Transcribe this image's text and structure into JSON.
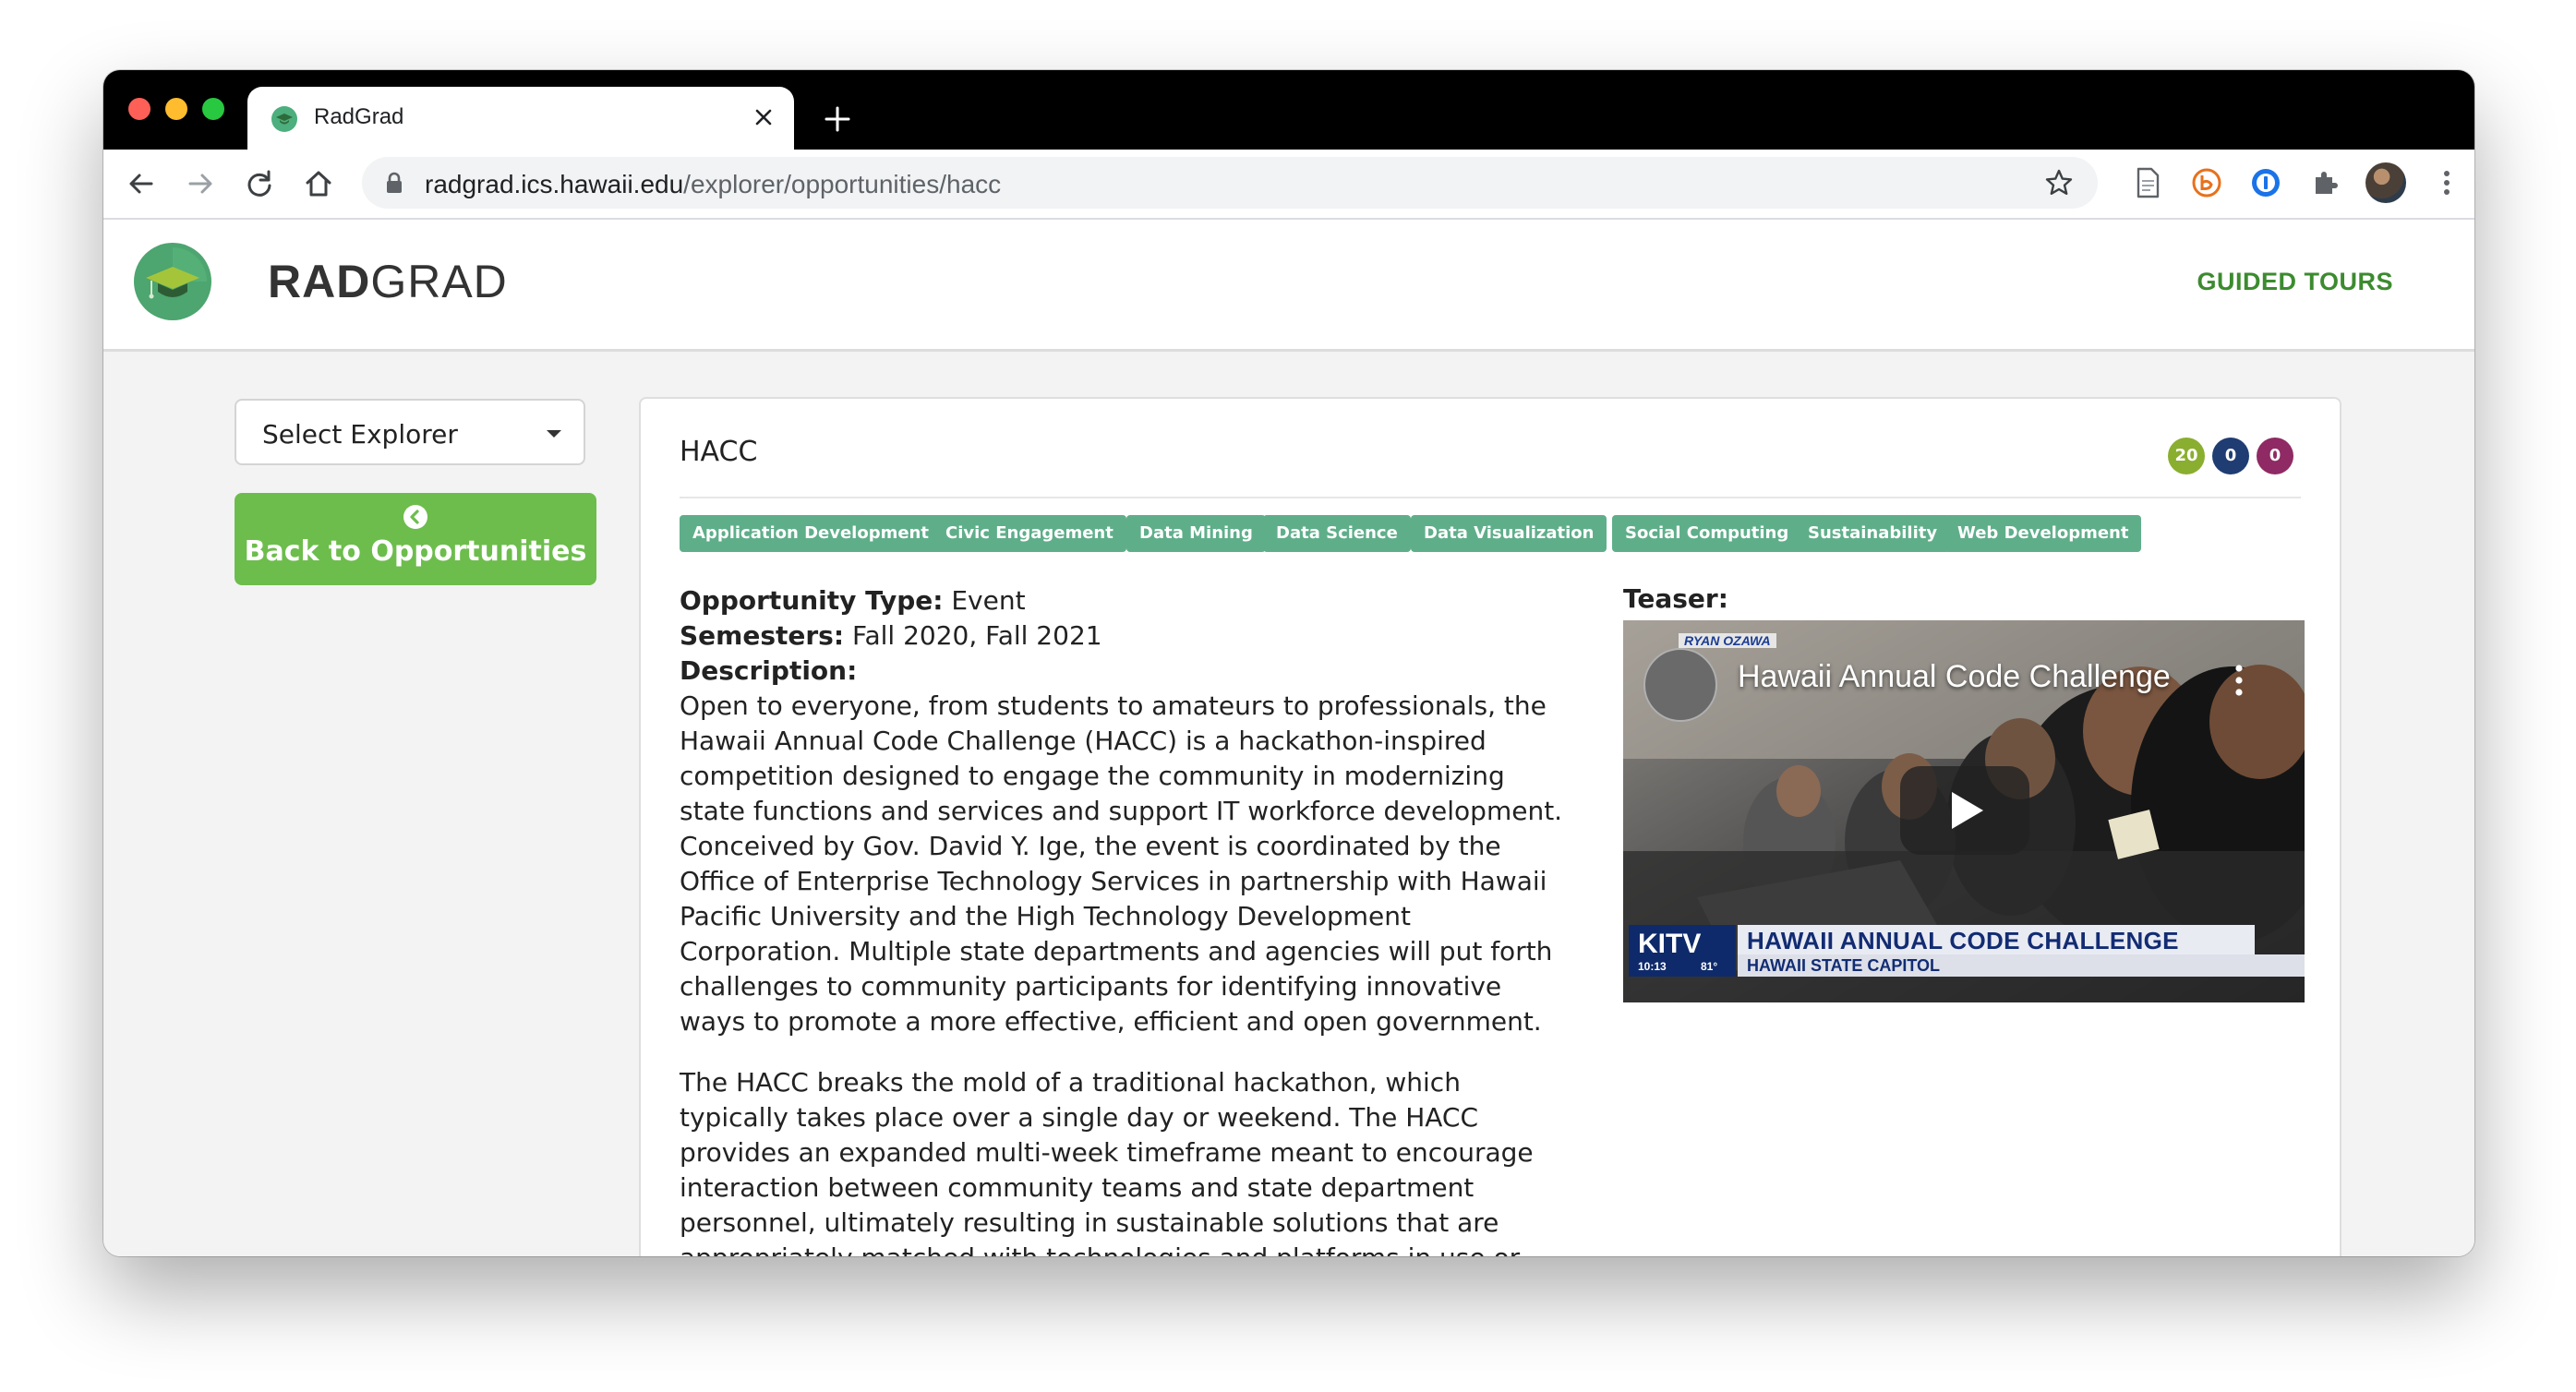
{
  "browser": {
    "tab_title": "RadGrad",
    "url_host": "radgrad.ics.hawaii.edu",
    "url_path": "/explorer/opportunities/hacc"
  },
  "header": {
    "brand_bold": "RAD",
    "brand_light": "GRAD",
    "guided_tours": "GUIDED TOURS"
  },
  "sidebar": {
    "select_explorer": "Select Explorer",
    "back_button": "Back to Opportunities"
  },
  "opportunity": {
    "title": "HACC",
    "badges": [
      {
        "value": "20",
        "color": "#8aae2f"
      },
      {
        "value": "0",
        "color": "#1f3c73"
      },
      {
        "value": "0",
        "color": "#8f2a64"
      }
    ],
    "tags": [
      "Application Development",
      "Civic Engagement",
      "Data Mining",
      "Data Science",
      "Data Visualization",
      "Social Computing",
      "Sustainability",
      "Web Development"
    ],
    "type_label": "Opportunity Type:",
    "type_value": " Event",
    "semesters_label": "Semesters:",
    "semesters_value": " Fall 2020, Fall 2021",
    "description_label": "Description:",
    "description_p1": "Open to everyone, from students to amateurs to professionals, the Hawaii Annual Code Challenge (HACC) is a hackathon-inspired competition designed to engage the community in modernizing state functions and services and support IT workforce development. Conceived by Gov. David Y. Ige, the event is coordinated by the Office of Enterprise Technology Services in partnership with Hawaii Pacific University and the High Technology Development Corporation. Multiple state departments and agencies will put forth challenges to community participants for identifying innovative ways to promote a more effective, efficient and open government.",
    "description_p2": "The HACC breaks the mold of a traditional hackathon, which typically takes place over a single day or weekend. The HACC provides an expanded multi-week timeframe meant to encourage interaction between community teams and state department personnel, ultimately resulting in sustainable solutions that are appropriately matched with technologies and platforms in use or being considered by the state."
  },
  "teaser": {
    "label": "Teaser:",
    "video_title": "Hawaii Annual Code Challenge",
    "overlay_tag": "RYAN OZAWA",
    "station": "KITV",
    "time": "10:13",
    "temp": "81°",
    "headline": "HAWAII ANNUAL CODE CHALLENGE",
    "subline": "HAWAII STATE CAPITOL"
  },
  "colors": {
    "accent_green": "#6dbd4d",
    "tag_green": "#5fae8a",
    "guided_tours": "#3c8b2f"
  }
}
